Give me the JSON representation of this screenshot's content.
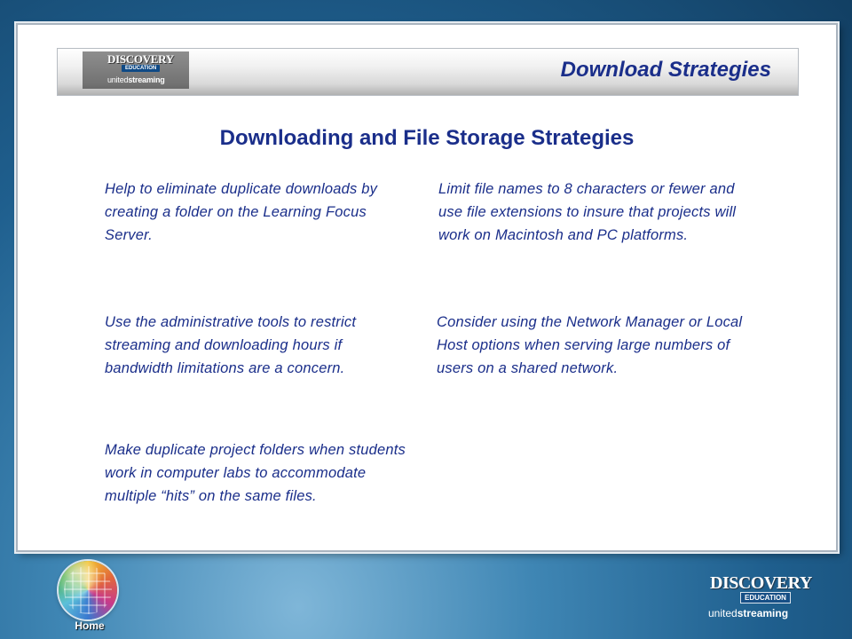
{
  "header": {
    "logo_line1": "DISCOVERY",
    "logo_line2": "EDUCATION",
    "logo_line3_prefix": "united",
    "logo_line3_bold": "streaming",
    "title": "Download Strategies"
  },
  "main": {
    "title": "Downloading and File Storage Strategies",
    "tips": [
      "Help to eliminate duplicate downloads by creating a folder on the Learning Focus Server.",
      "Limit file names to 8 characters or fewer and use file extensions to insure that projects will work on Macintosh and PC platforms.",
      "Use the administrative tools to restrict streaming and downloading hours if bandwidth limitations are a concern.",
      "Consider using the Network Manager or Local Host options when serving large numbers of users on a shared network.",
      "Make duplicate project folders when students work in computer labs to accommodate multiple “hits” on the same files."
    ]
  },
  "footer": {
    "home_label": "Home",
    "logo_line1": "DISCOVERY",
    "logo_line2": "EDUCATION",
    "logo_line3_prefix": "united",
    "logo_line3_bold": "streaming"
  },
  "colors": {
    "title_blue": "#1a2e8a",
    "background_blue": "#1f5f8e"
  },
  "icons": {
    "home": "globe-icon"
  }
}
